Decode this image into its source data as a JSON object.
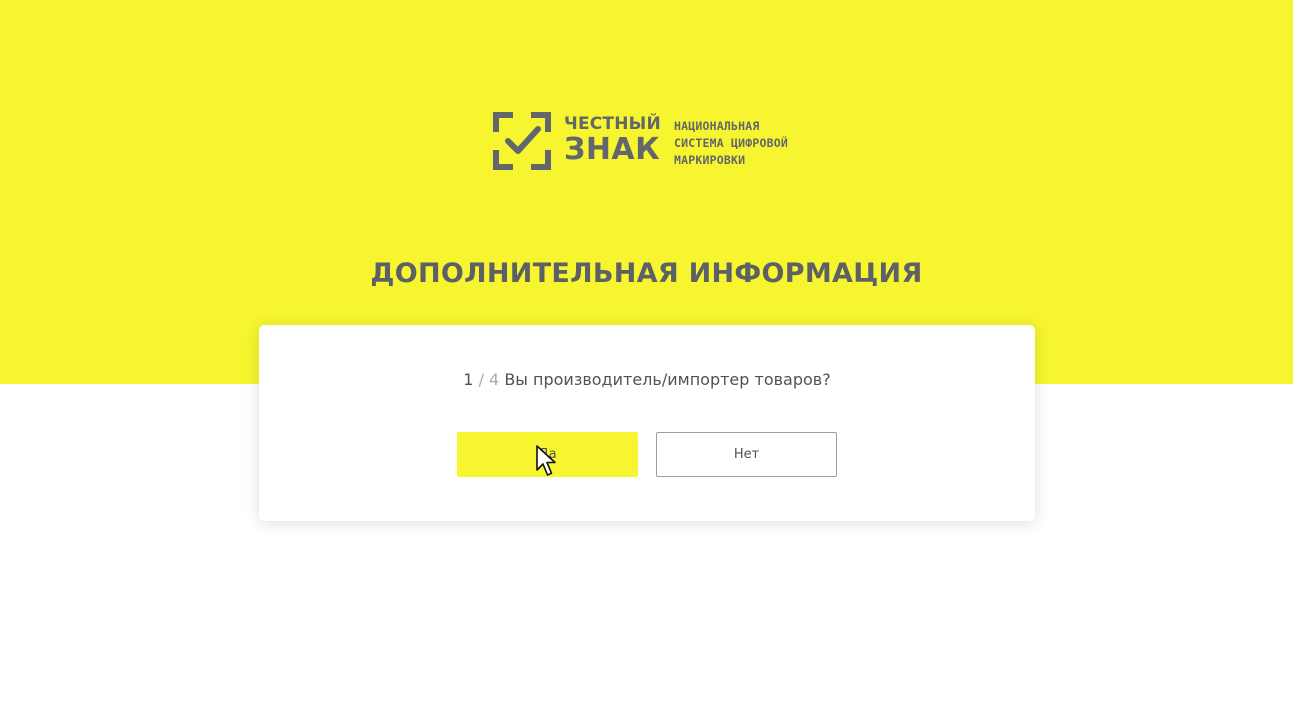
{
  "brand": {
    "name_line1": "ЧЕСТНЫЙ",
    "name_line2": "ЗНАК",
    "tagline": [
      "НАЦИОНАЛЬНАЯ",
      "СИСТЕМА ЦИФРОВОЙ",
      "МАРКИРОВКИ"
    ],
    "color": "#63666a",
    "accent": "#f6f52f"
  },
  "page": {
    "title": "ДОПОЛНИТЕЛЬНАЯ ИНФОРМАЦИЯ"
  },
  "question": {
    "current": "1",
    "separator": "/",
    "total": "4",
    "text": "Вы производитель/импортер товаров?"
  },
  "buttons": {
    "yes_label": "Да",
    "no_label": "Нет"
  },
  "icons": {
    "logo": "check-in-frame-icon",
    "pointer": "cursor-arrow-icon"
  }
}
